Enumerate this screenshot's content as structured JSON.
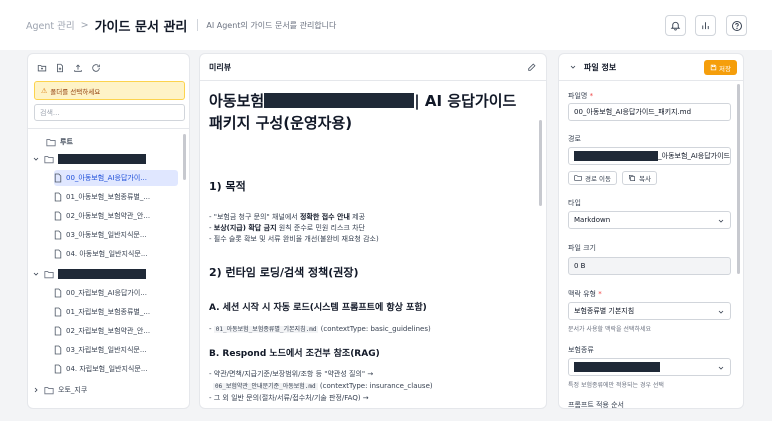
{
  "header": {
    "breadcrumb_parent": "Agent 관리",
    "breadcrumb_sep": ">",
    "title": "가이드 문서 관리",
    "description": "AI Agent의 가이드 문서를 관리합니다",
    "icons": [
      "bell-icon",
      "chart-icon",
      "help-icon"
    ]
  },
  "left_panel": {
    "warning": "폴더를 선택하세요",
    "search_placeholder": "검색...",
    "tree": {
      "root_label": "루트",
      "group1_items": [
        "00_아동보험_AI응답가이...",
        "01_아동보험_보험종류별_...",
        "02_아동보험_보험약관_안...",
        "03_아동보험_일반지식문...",
        "04. 아동보험_일반지식문..."
      ],
      "group2_items": [
        "00_자립보험_AI응답가이...",
        "01_자립보험_보험종류별_...",
        "02_자립보험_보험약관_안...",
        "03_자립보험_일반지식문...",
        "04. 자립보험_일반지식문..."
      ],
      "folder3_label": "오토_지쿠"
    }
  },
  "preview": {
    "title": "미리뷰",
    "doc_title_prefix": "아동보험",
    "doc_title_suffix": "| AI 응답가이드",
    "doc_title_line2": "패키지 구성(운영자용)",
    "sec1_title": "1) 목적",
    "sec1_b1_a": "- \"보험금 청구 문의\" 채널에서 ",
    "sec1_b1_bold": "정확한 접수 안내",
    "sec1_b1_c": " 제공",
    "sec1_b2_a": "- ",
    "sec1_b2_bold": "보상(지급) 확답 금지",
    "sec1_b2_c": " 원칙 준수로 민원 리스크 차단",
    "sec1_b3": "- 필수 슬롯 확보 및 서류 완비율 개선(불완비 재요청 감소)",
    "sec2_title": "2) 런타임 로딩/검색 정책(권장)",
    "subA_title": "A. 세션 시작 시 자동 로드(시스템 프롬프트에 항상 포함)",
    "subA_b1_prefix": "- ",
    "subA_b1_code": "01_아동보험_보험종류별_기본지침.md",
    "subA_b1_suffix": " (contextType: basic_guidelines)",
    "subB_title": "B. Respond 노드에서 조건부 참조(RAG)",
    "subB_b1": "- 약관/면책/지급기준/보장범위/조항 등 \"약관성 질의\" →",
    "subB_b2_code": "06_보험약관_안내문기준_아동보험.md",
    "subB_b2_suffix": " (contextType: insurance_clause)",
    "subB_b3": "- 그 외 일반 문의(절차/서류/접수처/기술 판정/FAQ) →"
  },
  "file_info": {
    "title": "파일 정보",
    "save_label": "저장",
    "filename_label": "파일명",
    "required_mark": "*",
    "filename_value": "00_아동보험_AI응답가이드_패키지.md",
    "path_label": "경로",
    "path_value_suffix": "_아동보험_AI응답가이드",
    "move_path_label": "경로 이동",
    "copy_label": "복사",
    "type_label": "타입",
    "type_value": "Markdown",
    "size_label": "파일 크기",
    "size_value": "0 B",
    "context_label": "맥락 유형",
    "context_value": "보험종류별 기본지침",
    "context_hint": "문서가 사용할 맥락을 선택하세요",
    "insurance_label": "보험종류",
    "insurance_hint": "특정 보험종류에만 적용되는 경우 선택",
    "priority_label": "프롬프트 적용 순서"
  }
}
